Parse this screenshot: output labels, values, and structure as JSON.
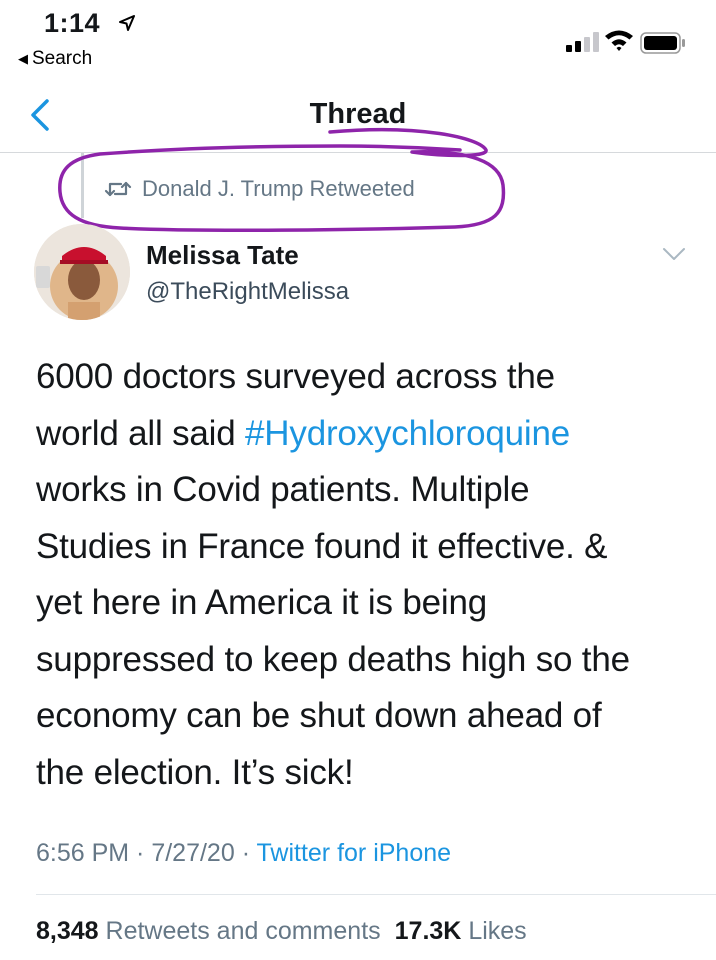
{
  "status_bar": {
    "time": "1:14",
    "back_label": "Search"
  },
  "nav": {
    "title": "Thread"
  },
  "retweet_context": {
    "text": "Donald J. Trump Retweeted"
  },
  "author": {
    "name": "Melissa Tate",
    "handle": "@TheRightMelissa"
  },
  "tweet": {
    "line1": "6000 doctors surveyed across the",
    "line2_pre": "world all said ",
    "hashtag": "#Hydroxychloroquine",
    "line3": "works in Covid patients. Multiple",
    "line4": "Studies in France found it effective. &",
    "line5": "yet here in America it is being",
    "line6": "suppressed to keep deaths high so the",
    "line7": "economy can be shut down ahead of",
    "line8": "the election. It’s sick!"
  },
  "meta": {
    "time": "6:56 PM",
    "sep1": " · ",
    "date": "7/27/20",
    "sep2": " · ",
    "source": "Twitter for iPhone"
  },
  "stats": {
    "retweets_count": "8,348",
    "retweets_label": "Retweets and comments",
    "likes_count": "17.3K",
    "likes_label": "Likes"
  },
  "colors": {
    "link_blue": "#1b95e0",
    "annotation_purple": "#8e24aa",
    "muted_gray": "#657786"
  },
  "icons": [
    "location-arrow-icon",
    "back-triangle-icon",
    "signal-icon",
    "wifi-icon",
    "battery-icon",
    "back-chevron-icon",
    "retweet-icon",
    "chevron-down-icon"
  ]
}
